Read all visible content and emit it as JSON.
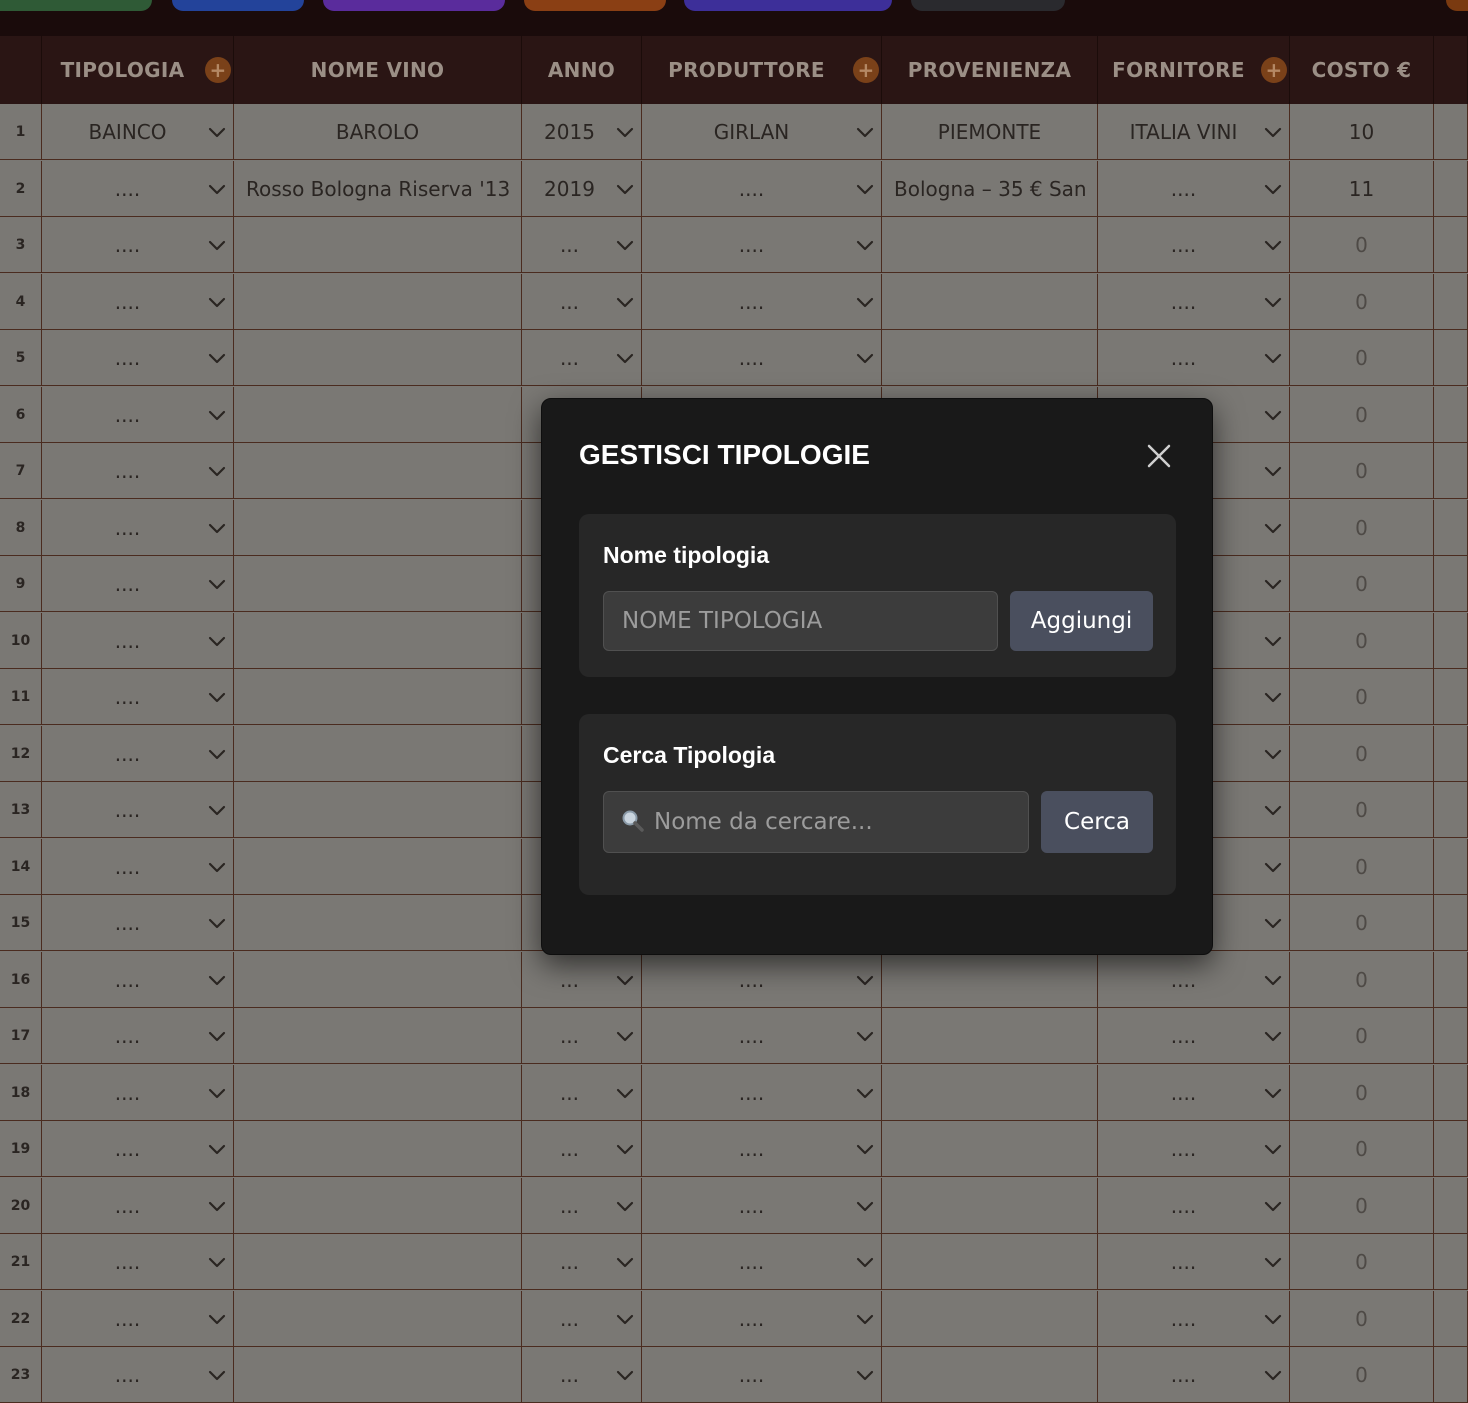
{
  "toolbar": {
    "buttons": [
      {
        "color": "#2f5a36"
      },
      {
        "color": "#23439a"
      },
      {
        "color": "#5a2c9c"
      },
      {
        "color": "#8a3f14"
      },
      {
        "color": "#3d2f99"
      },
      {
        "color": "#2a2a2e"
      },
      {
        "color": "#7a3a10"
      }
    ]
  },
  "table": {
    "columns": [
      {
        "label": "",
        "add": false
      },
      {
        "label": "TIPOLOGIA",
        "add": true
      },
      {
        "label": "NOME VINO",
        "add": false
      },
      {
        "label": "ANNO",
        "add": false
      },
      {
        "label": "PRODUTTORE",
        "add": true
      },
      {
        "label": "PROVENIENZA",
        "add": false
      },
      {
        "label": "FORNITORE",
        "add": true
      },
      {
        "label": "COSTO €",
        "add": false
      }
    ],
    "rows": [
      {
        "n": "1",
        "tipologia": "BAINCO",
        "nome": "BAROLO",
        "anno": "2015",
        "produttore": "GIRLAN",
        "provenienza": "PIEMONTE",
        "fornitore": "ITALIA VINI",
        "costo": "10"
      },
      {
        "n": "2",
        "tipologia": "....",
        "nome": "Rosso Bologna Riserva '13",
        "anno": "2019",
        "produttore": "....",
        "provenienza": "Bologna – 35 € San",
        "fornitore": "....",
        "costo": "11"
      },
      {
        "n": "3",
        "tipologia": "....",
        "nome": "",
        "anno": "...",
        "produttore": "....",
        "provenienza": "",
        "fornitore": "....",
        "costo": "0"
      },
      {
        "n": "4",
        "tipologia": "....",
        "nome": "",
        "anno": "...",
        "produttore": "....",
        "provenienza": "",
        "fornitore": "....",
        "costo": "0"
      },
      {
        "n": "5",
        "tipologia": "....",
        "nome": "",
        "anno": "...",
        "produttore": "....",
        "provenienza": "",
        "fornitore": "....",
        "costo": "0"
      },
      {
        "n": "6",
        "tipologia": "....",
        "nome": "",
        "anno": "...",
        "produttore": "....",
        "provenienza": "",
        "fornitore": "....",
        "costo": "0"
      },
      {
        "n": "7",
        "tipologia": "....",
        "nome": "",
        "anno": "...",
        "produttore": "....",
        "provenienza": "",
        "fornitore": "....",
        "costo": "0"
      },
      {
        "n": "8",
        "tipologia": "....",
        "nome": "",
        "anno": "...",
        "produttore": "....",
        "provenienza": "",
        "fornitore": "....",
        "costo": "0"
      },
      {
        "n": "9",
        "tipologia": "....",
        "nome": "",
        "anno": "...",
        "produttore": "....",
        "provenienza": "",
        "fornitore": "....",
        "costo": "0"
      },
      {
        "n": "10",
        "tipologia": "....",
        "nome": "",
        "anno": "...",
        "produttore": "....",
        "provenienza": "",
        "fornitore": "....",
        "costo": "0"
      },
      {
        "n": "11",
        "tipologia": "....",
        "nome": "",
        "anno": "...",
        "produttore": "....",
        "provenienza": "",
        "fornitore": "....",
        "costo": "0"
      },
      {
        "n": "12",
        "tipologia": "....",
        "nome": "",
        "anno": "...",
        "produttore": "....",
        "provenienza": "",
        "fornitore": "....",
        "costo": "0"
      },
      {
        "n": "13",
        "tipologia": "....",
        "nome": "",
        "anno": "...",
        "produttore": "....",
        "provenienza": "",
        "fornitore": "....",
        "costo": "0"
      },
      {
        "n": "14",
        "tipologia": "....",
        "nome": "",
        "anno": "...",
        "produttore": "....",
        "provenienza": "",
        "fornitore": "....",
        "costo": "0"
      },
      {
        "n": "15",
        "tipologia": "....",
        "nome": "",
        "anno": "...",
        "produttore": "....",
        "provenienza": "",
        "fornitore": "....",
        "costo": "0"
      },
      {
        "n": "16",
        "tipologia": "....",
        "nome": "",
        "anno": "...",
        "produttore": "....",
        "provenienza": "",
        "fornitore": "....",
        "costo": "0"
      },
      {
        "n": "17",
        "tipologia": "....",
        "nome": "",
        "anno": "...",
        "produttore": "....",
        "provenienza": "",
        "fornitore": "....",
        "costo": "0"
      },
      {
        "n": "18",
        "tipologia": "....",
        "nome": "",
        "anno": "...",
        "produttore": "....",
        "provenienza": "",
        "fornitore": "....",
        "costo": "0"
      },
      {
        "n": "19",
        "tipologia": "....",
        "nome": "",
        "anno": "...",
        "produttore": "....",
        "provenienza": "",
        "fornitore": "....",
        "costo": "0"
      },
      {
        "n": "20",
        "tipologia": "....",
        "nome": "",
        "anno": "...",
        "produttore": "....",
        "provenienza": "",
        "fornitore": "....",
        "costo": "0"
      },
      {
        "n": "21",
        "tipologia": "....",
        "nome": "",
        "anno": "...",
        "produttore": "....",
        "provenienza": "",
        "fornitore": "....",
        "costo": "0"
      },
      {
        "n": "22",
        "tipologia": "....",
        "nome": "",
        "anno": "...",
        "produttore": "....",
        "provenienza": "",
        "fornitore": "....",
        "costo": "0"
      },
      {
        "n": "23",
        "tipologia": "....",
        "nome": "",
        "anno": "...",
        "produttore": "....",
        "provenienza": "",
        "fornitore": "....",
        "costo": "0"
      }
    ]
  },
  "modal": {
    "title": "GESTISCI TIPOLOGIE",
    "close_icon": "close-icon",
    "add_section": {
      "label": "Nome tipologia",
      "input_placeholder": "NOME TIPOLOGIA",
      "input_value": "",
      "button_label": "Aggiungi"
    },
    "search_section": {
      "label": "Cerca Tipologia",
      "input_placeholder": "Nome da cercare...",
      "input_value": "",
      "search_icon": "search-icon",
      "button_label": "Cerca"
    }
  }
}
